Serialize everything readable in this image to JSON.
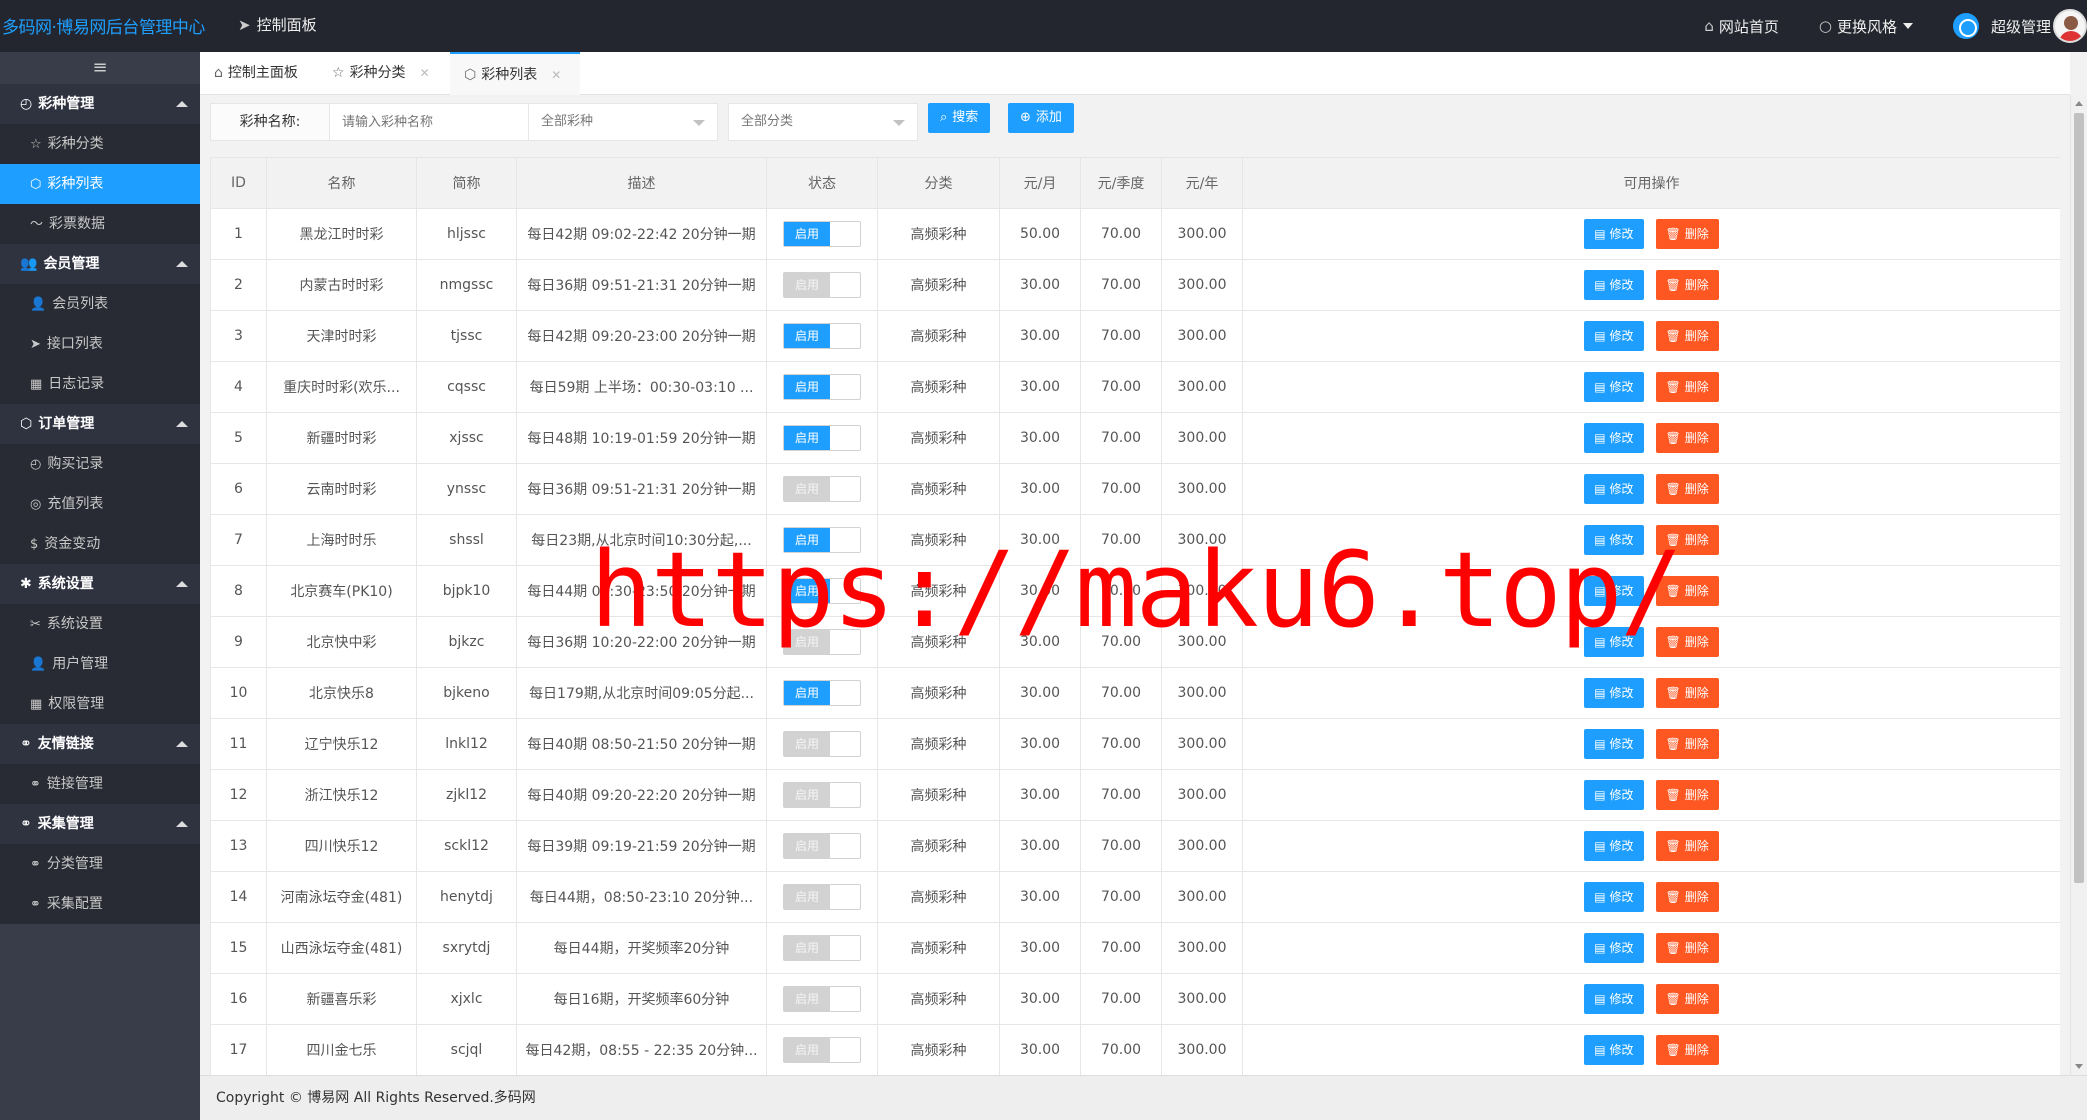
{
  "app": {
    "logo": "多码网·博易网后台管理中心",
    "dashboard_link": "控制面板",
    "site_home": "网站首页",
    "change_style": "更换风格",
    "user": "超级管理"
  },
  "sidebar": {
    "toggle_icon": "≡",
    "groups": [
      {
        "label": "彩种管理",
        "items": [
          "彩种分类",
          "彩种列表",
          "彩票数据"
        ]
      },
      {
        "label": "会员管理",
        "items": [
          "会员列表",
          "接口列表",
          "日志记录"
        ]
      },
      {
        "label": "订单管理",
        "items": [
          "购买记录",
          "充值列表",
          "资金变动"
        ]
      },
      {
        "label": "系统设置",
        "items": [
          "系统设置",
          "用户管理",
          "权限管理"
        ]
      },
      {
        "label": "友情链接",
        "items": [
          "链接管理"
        ]
      },
      {
        "label": "采集管理",
        "items": [
          "分类管理",
          "采集配置"
        ]
      }
    ],
    "active_item": "彩种列表"
  },
  "tabs": [
    {
      "label": "控制主面板",
      "icon": "home-icon"
    },
    {
      "label": "彩种分类",
      "icon": "star-icon"
    },
    {
      "label": "彩种列表",
      "icon": "cube-icon"
    }
  ],
  "toolbar": {
    "name_label": "彩种名称:",
    "name_placeholder": "请输入彩种名称",
    "select_lottery": "全部彩种",
    "select_category": "全部分类",
    "search_label": "搜索",
    "add_label": "添加"
  },
  "table": {
    "headers": [
      "ID",
      "名称",
      "简称",
      "描述",
      "状态",
      "分类",
      "元/月",
      "元/季度",
      "元/年",
      "可用操作"
    ],
    "status_label": "启用",
    "edit_label": "修改",
    "delete_label": "删除",
    "rows": [
      {
        "id": "1",
        "name": "黑龙江时时彩",
        "short": "hljssc",
        "desc": "每日42期 09:02-22:42 20分钟一期",
        "on": true,
        "cat": "高频彩种",
        "month": "50.00",
        "quarter": "70.00",
        "year": "300.00"
      },
      {
        "id": "2",
        "name": "内蒙古时时彩",
        "short": "nmgssc",
        "desc": "每日36期 09:51-21:31 20分钟一期",
        "on": false,
        "cat": "高频彩种",
        "month": "30.00",
        "quarter": "70.00",
        "year": "300.00"
      },
      {
        "id": "3",
        "name": "天津时时彩",
        "short": "tjssc",
        "desc": "每日42期 09:20-23:00 20分钟一期",
        "on": true,
        "cat": "高频彩种",
        "month": "30.00",
        "quarter": "70.00",
        "year": "300.00"
      },
      {
        "id": "4",
        "name": "重庆时时彩(欢乐...",
        "short": "cqssc",
        "desc": "每日59期 上半场：00:30-03:10 ...",
        "on": true,
        "cat": "高频彩种",
        "month": "30.00",
        "quarter": "70.00",
        "year": "300.00"
      },
      {
        "id": "5",
        "name": "新疆时时彩",
        "short": "xjssc",
        "desc": "每日48期 10:19-01:59 20分钟一期",
        "on": true,
        "cat": "高频彩种",
        "month": "30.00",
        "quarter": "70.00",
        "year": "300.00"
      },
      {
        "id": "6",
        "name": "云南时时彩",
        "short": "ynssc",
        "desc": "每日36期 09:51-21:31 20分钟一期",
        "on": false,
        "cat": "高频彩种",
        "month": "30.00",
        "quarter": "70.00",
        "year": "300.00"
      },
      {
        "id": "7",
        "name": "上海时时乐",
        "short": "shssl",
        "desc": "每日23期,从北京时间10:30分起,...",
        "on": true,
        "cat": "高频彩种",
        "month": "30.00",
        "quarter": "70.00",
        "year": "300.00"
      },
      {
        "id": "8",
        "name": "北京赛车(PK10)",
        "short": "bjpk10",
        "desc": "每日44期 09:30-23:50 20分钟一期",
        "on": true,
        "cat": "高频彩种",
        "month": "30.00",
        "quarter": "70.00",
        "year": "300.00"
      },
      {
        "id": "9",
        "name": "北京快中彩",
        "short": "bjkzc",
        "desc": "每日36期 10:20-22:00 20分钟一期",
        "on": false,
        "cat": "高频彩种",
        "month": "30.00",
        "quarter": "70.00",
        "year": "300.00"
      },
      {
        "id": "10",
        "name": "北京快乐8",
        "short": "bjkeno",
        "desc": "每日179期,从北京时间09:05分起...",
        "on": true,
        "cat": "高频彩种",
        "month": "30.00",
        "quarter": "70.00",
        "year": "300.00"
      },
      {
        "id": "11",
        "name": "辽宁快乐12",
        "short": "lnkl12",
        "desc": "每日40期 08:50-21:50 20分钟一期",
        "on": false,
        "cat": "高频彩种",
        "month": "30.00",
        "quarter": "70.00",
        "year": "300.00"
      },
      {
        "id": "12",
        "name": "浙江快乐12",
        "short": "zjkl12",
        "desc": "每日40期 09:20-22:20 20分钟一期",
        "on": false,
        "cat": "高频彩种",
        "month": "30.00",
        "quarter": "70.00",
        "year": "300.00"
      },
      {
        "id": "13",
        "name": "四川快乐12",
        "short": "sckl12",
        "desc": "每日39期 09:19-21:59 20分钟一期",
        "on": false,
        "cat": "高频彩种",
        "month": "30.00",
        "quarter": "70.00",
        "year": "300.00"
      },
      {
        "id": "14",
        "name": "河南泳坛夺金(481)",
        "short": "henytdj",
        "desc": "每日44期，08:50-23:10 20分钟...",
        "on": false,
        "cat": "高频彩种",
        "month": "30.00",
        "quarter": "70.00",
        "year": "300.00"
      },
      {
        "id": "15",
        "name": "山西泳坛夺金(481)",
        "short": "sxrytdj",
        "desc": "每日44期，开奖频率20分钟",
        "on": false,
        "cat": "高频彩种",
        "month": "30.00",
        "quarter": "70.00",
        "year": "300.00"
      },
      {
        "id": "16",
        "name": "新疆喜乐彩",
        "short": "xjxlc",
        "desc": "每日16期，开奖频率60分钟",
        "on": false,
        "cat": "高频彩种",
        "month": "30.00",
        "quarter": "70.00",
        "year": "300.00"
      },
      {
        "id": "17",
        "name": "四川金七乐",
        "short": "scjql",
        "desc": "每日42期，08:55 - 22:35 20分钟...",
        "on": false,
        "cat": "高频彩种",
        "month": "30.00",
        "quarter": "70.00",
        "year": "300.00"
      }
    ]
  },
  "footer": {
    "text": "Copyright © 博易网 All Rights Reserved.多码网"
  },
  "watermark": {
    "text": "https://maku6.top/"
  },
  "colors": {
    "primary": "#1e9fff",
    "danger": "#ff5722",
    "topbar": "#23262e",
    "sidebar": "#393d49"
  }
}
